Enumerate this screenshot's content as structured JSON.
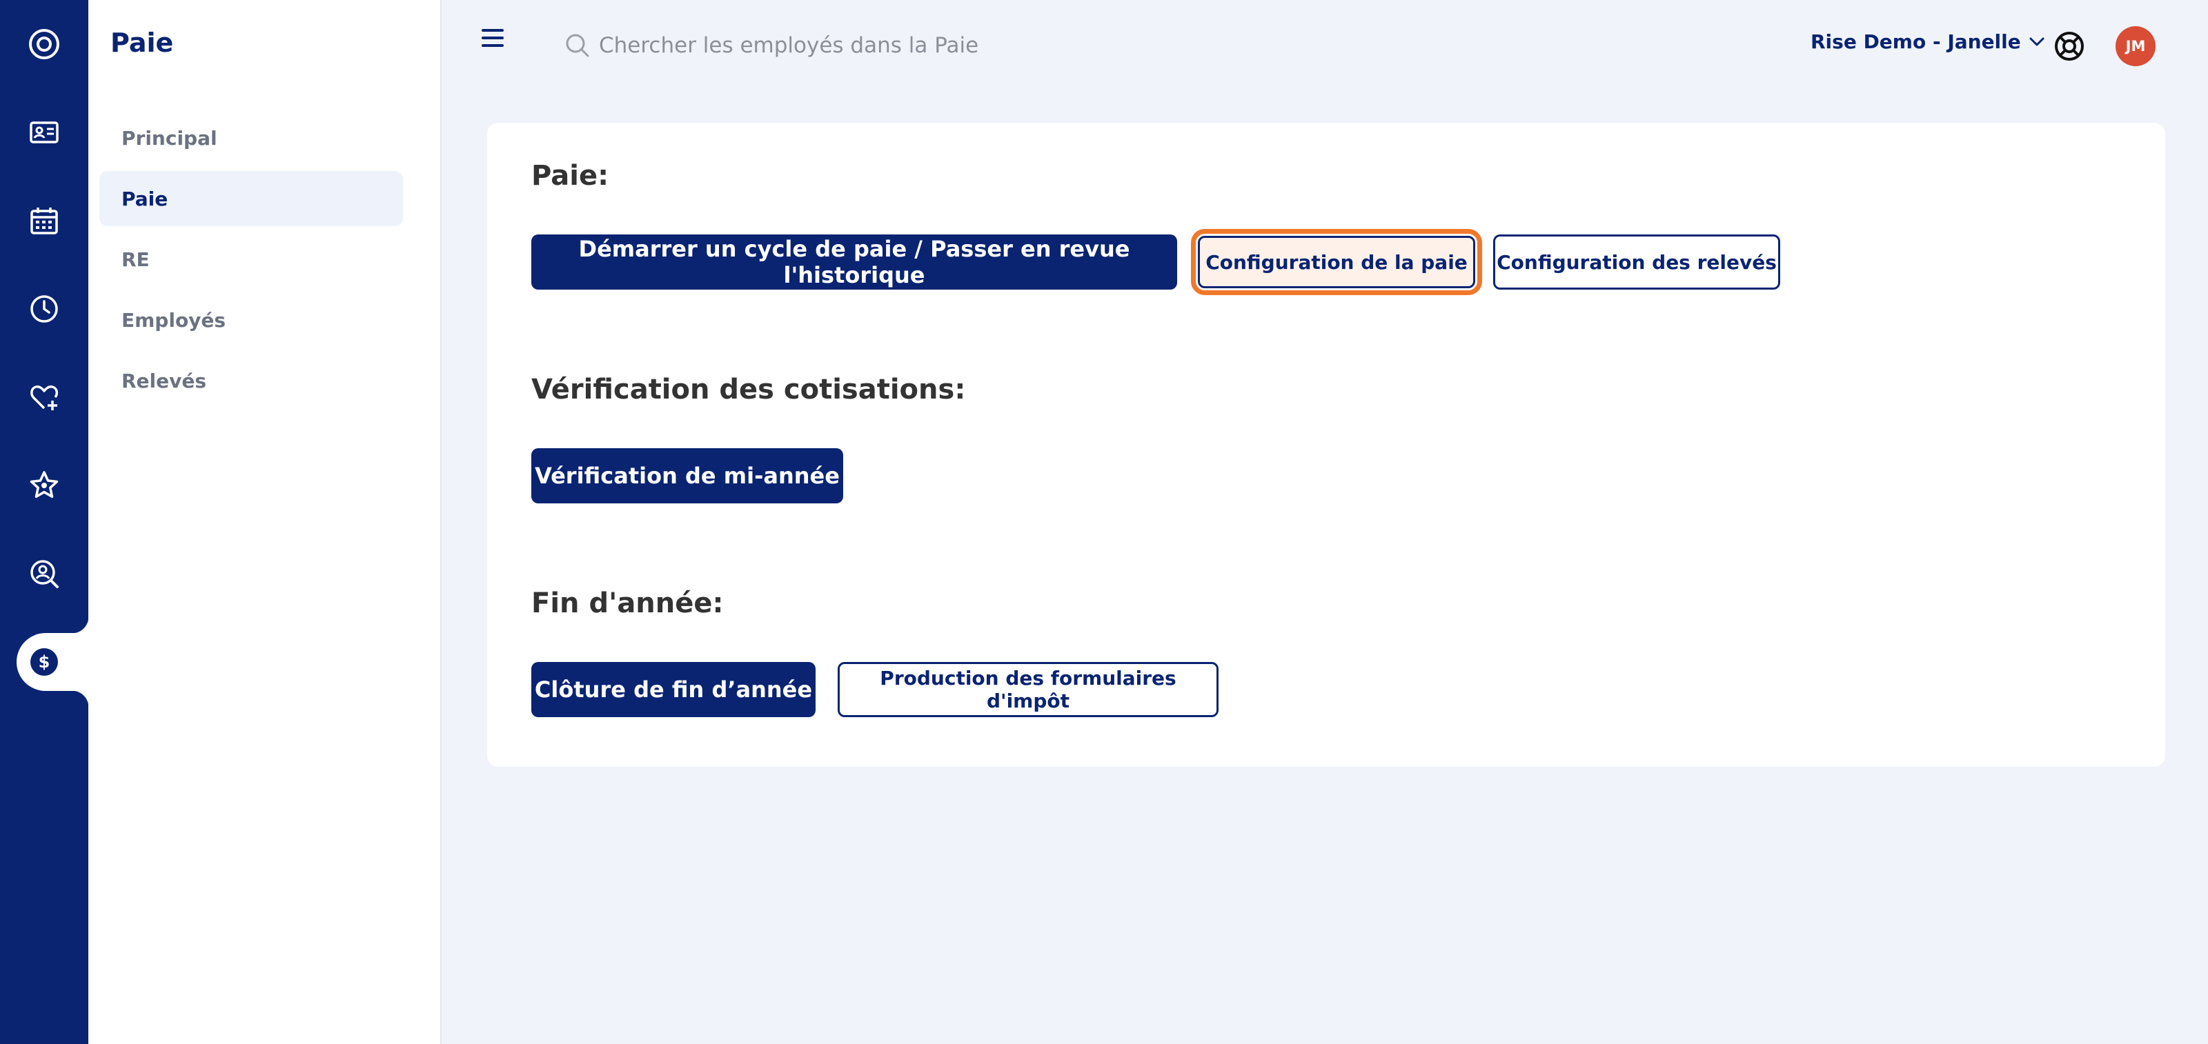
{
  "rail": {
    "items": [
      {
        "icon": "app-logo-icon"
      },
      {
        "icon": "id-card-icon"
      },
      {
        "icon": "calendar-icon"
      },
      {
        "icon": "clock-icon"
      },
      {
        "icon": "heart-plus-icon"
      },
      {
        "icon": "star-icon"
      },
      {
        "icon": "user-search-icon"
      },
      {
        "icon": "dollar-icon",
        "active": true
      }
    ]
  },
  "subnav": {
    "title": "Paie",
    "items": [
      {
        "label": "Principal"
      },
      {
        "label": "Paie",
        "active": true
      },
      {
        "label": "RE"
      },
      {
        "label": "Employés"
      },
      {
        "label": "Relevés"
      }
    ]
  },
  "header": {
    "search_placeholder": "Chercher les employés dans la Paie",
    "user_label": "Rise Demo - Janelle",
    "avatar_initials": "JM"
  },
  "main": {
    "sections": [
      {
        "title": "Paie:",
        "buttons": [
          {
            "label": "Démarrer un cycle de paie / Passer en revue l'historique"
          },
          {
            "label": "Configuration de la paie"
          },
          {
            "label": "Configuration des relevés"
          }
        ]
      },
      {
        "title": "Vérification des cotisations:",
        "buttons": [
          {
            "label": "Vérification de mi-année"
          }
        ]
      },
      {
        "title": "Fin d'année:",
        "buttons": [
          {
            "label": "Clôture de fin d’année"
          },
          {
            "label": "Production des formulaires d'impôt"
          }
        ]
      }
    ]
  },
  "colors": {
    "brand": "#0a2472",
    "highlight": "#f0782a",
    "avatar": "#d94c36"
  }
}
